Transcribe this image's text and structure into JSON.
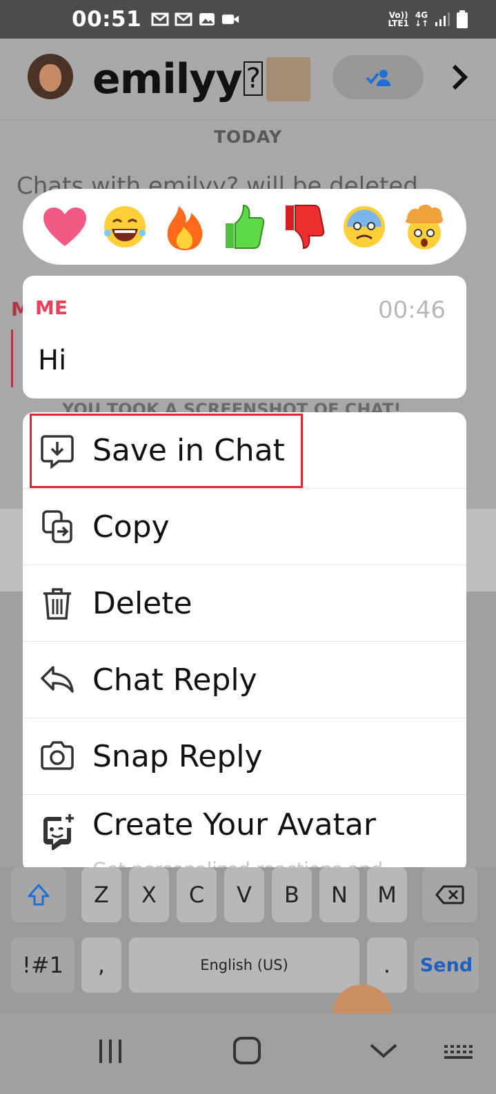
{
  "status_bar": {
    "time": "00:51",
    "network_top": "Vo))",
    "network_bottom": "LTE1",
    "network_type": "4G"
  },
  "header": {
    "title": "emilyy",
    "title_glyph": "?"
  },
  "chat": {
    "date_divider": "TODAY",
    "deleted_notice": "Chats with emilyy? will be deleted...",
    "bg_sender_letter": "M",
    "screenshot_notice": "YOU TOOK A SCREENSHOT OF CHAT!"
  },
  "reactions": [
    {
      "name": "heart",
      "icon": "heart-icon"
    },
    {
      "name": "laughing",
      "icon": "laughing-face-icon"
    },
    {
      "name": "fire",
      "icon": "fire-icon"
    },
    {
      "name": "thumbs-up",
      "icon": "thumbs-up-icon"
    },
    {
      "name": "thumbs-down",
      "icon": "thumbs-down-icon"
    },
    {
      "name": "anxious",
      "icon": "anxious-face-icon"
    },
    {
      "name": "mind-blown",
      "icon": "exploding-head-icon"
    }
  ],
  "message": {
    "sender": "ME",
    "time": "00:46",
    "text": "Hi"
  },
  "context_menu": {
    "items": [
      {
        "label": "Save in Chat",
        "icon": "save-in-chat-icon",
        "highlighted": true
      },
      {
        "label": "Copy",
        "icon": "copy-icon"
      },
      {
        "label": "Delete",
        "icon": "trash-icon"
      },
      {
        "label": "Chat Reply",
        "icon": "reply-arrow-icon"
      },
      {
        "label": "Snap Reply",
        "icon": "camera-icon"
      },
      {
        "label": "Create Your Avatar",
        "icon": "avatar-face-icon"
      }
    ],
    "avatar_subtext": "Get personalized reactions and..."
  },
  "keyboard": {
    "row3": [
      "Z",
      "X",
      "C",
      "V",
      "B",
      "N",
      "M"
    ],
    "symbols_key": "!#1",
    "comma_key": ",",
    "space_key": "English (US)",
    "period_key": ".",
    "send_key": "Send"
  },
  "colors": {
    "accent_red": "#e8415b",
    "highlight_red": "#e0252f",
    "send_blue": "#1f5fbf"
  }
}
